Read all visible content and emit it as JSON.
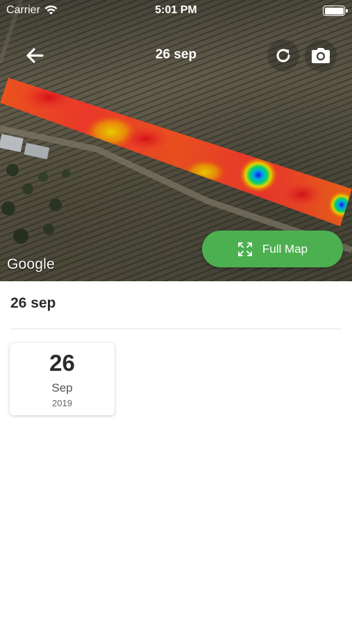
{
  "status_bar": {
    "carrier": "Carrier",
    "time": "5:01 PM"
  },
  "nav": {
    "title": "26 sep",
    "back_icon": "arrow-left-icon",
    "refresh_icon": "refresh-icon",
    "camera_icon": "camera-icon"
  },
  "map": {
    "provider_logo": "Google",
    "heatmap_colors": [
      "#ff3d00",
      "#ff6d00",
      "#ffd600",
      "#00c853",
      "#2962ff"
    ],
    "full_map_button": {
      "label": "Full Map",
      "icon": "expand-icon",
      "color": "#4caf50"
    }
  },
  "content": {
    "section_title": "26 sep",
    "date_card": {
      "day": "26",
      "month": "Sep",
      "year": "2019"
    }
  }
}
